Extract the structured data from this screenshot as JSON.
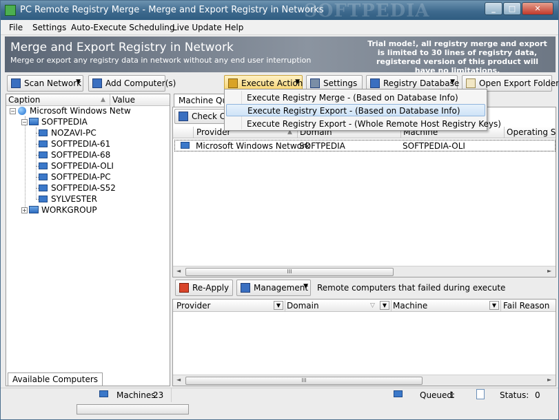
{
  "window": {
    "title": "PC Remote Registry Merge - Merge and Export Registry in Networks",
    "watermark": "SOFTPEDIA"
  },
  "menubar": {
    "items": [
      "File",
      "Settings",
      "Auto-Execute Scheduling",
      "Live Update",
      "Help"
    ]
  },
  "banner": {
    "title": "Merge and Export Registry in Network",
    "subtitle": "Merge or export any registry data in network without any end user interruption",
    "trial_notice": "Trial mode!, all registry merge and export is limited to 30 lines of registry data, registered version of this product will have no limitations."
  },
  "toolbar": {
    "scan_network": "Scan Network",
    "add_computers": "Add Computer(s)",
    "execute_action": "Execute Action",
    "settings": "Settings",
    "registry_database": "Registry Database",
    "open_export_folder": "Open Export Folder"
  },
  "left_panel": {
    "columns": {
      "caption": "Caption",
      "value": "Value"
    },
    "tree": {
      "root": "Microsoft Windows Netw",
      "domain": "SOFTPEDIA",
      "machines": [
        "NOZAVI-PC",
        "SOFTPEDIA-61",
        "SOFTPEDIA-68",
        "SOFTPEDIA-OLI",
        "SOFTPEDIA-PC",
        "SOFTPEDIA-S52",
        "SYLVESTER"
      ],
      "workgroup": "WORKGROUP"
    },
    "tab": "Available Computers",
    "status": {
      "label": "Machines:",
      "count": "23"
    }
  },
  "right_panel": {
    "tab": "Machine Que",
    "check_button": "Check Con",
    "columns": {
      "provider": "Provider",
      "domain": "Domain",
      "machine": "Machine",
      "os": "Operating Syst"
    },
    "rows": [
      {
        "provider": "Microsoft Windows Network",
        "domain": "SOFTPEDIA",
        "machine": "SOFTPEDIA-OLI",
        "os": ""
      }
    ],
    "reapply": "Re-Apply",
    "management": "Management",
    "failed_label": "Remote computers that failed during execute",
    "failed_columns": {
      "provider": "Provider",
      "domain": "Domain",
      "machine": "Machine",
      "reason": "Fail Reason"
    },
    "status": {
      "queued_label": "Queued:",
      "queued": "1",
      "status_label": "Status:",
      "status": "0"
    }
  },
  "dropdown_menu": {
    "items": [
      "Execute Registry Merge - (Based on Database Info)",
      "Execute Registry Export - (Based on Database Info)",
      "Execute Registry Export - (Whole Remote Host Registry Keys)"
    ],
    "selected_index": 1
  },
  "scrollbar": {
    "glyph": "III"
  },
  "colors": {
    "accent": "#3e6a8e",
    "highlight": "#cfe3f7",
    "banner": "#6d7784"
  }
}
